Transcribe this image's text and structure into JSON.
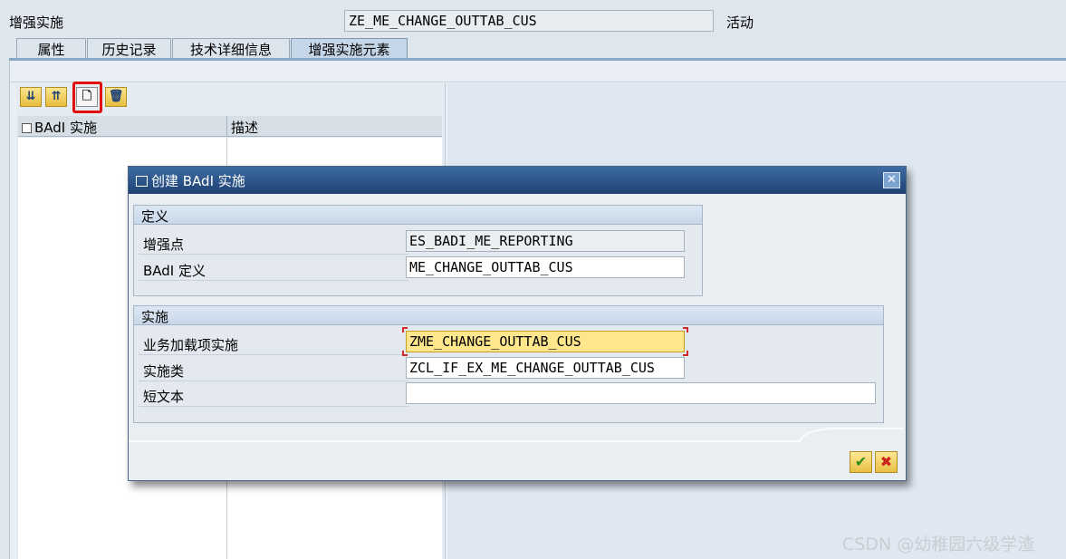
{
  "header": {
    "label": "增强实施",
    "object_name": "ZE_ME_CHANGE_OUTTAB_CUS",
    "status": "活动"
  },
  "tabs": [
    {
      "label": "属性"
    },
    {
      "label": "历史记录"
    },
    {
      "label": "技术详细信息"
    },
    {
      "label": "增强实施元素"
    }
  ],
  "toolbar": {
    "expand_icon": "expand-all-icon",
    "collapse_icon": "collapse-all-icon",
    "create_icon": "new-document-icon",
    "delete_icon": "trash-icon"
  },
  "tree": {
    "col1": "BAdI 实施",
    "col2": "描述"
  },
  "dialog": {
    "title": "创建 BAdI 实施",
    "definition": {
      "header": "定义",
      "enh_spot_label": "增强点",
      "enh_spot_value": "ES_BADI_ME_REPORTING",
      "badi_def_label": "BAdI 定义",
      "badi_def_value": "ME_CHANGE_OUTTAB_CUS"
    },
    "implementation": {
      "header": "实施",
      "impl_label": "业务加载项实施",
      "impl_value": "ZME_CHANGE_OUTTAB_CUS",
      "class_label": "实施类",
      "class_value": "ZCL_IF_EX_ME_CHANGE_OUTTAB_CUS",
      "short_text_label": "短文本",
      "short_text_value": ""
    },
    "ok_icon": "checkmark-icon",
    "cancel_icon": "cancel-x-icon"
  },
  "watermark": "CSDN @幼稚园六级学渣",
  "colors": {
    "title_bar": "#1e4173",
    "focus_field": "#fde68c",
    "highlight": "#e20b0b"
  }
}
